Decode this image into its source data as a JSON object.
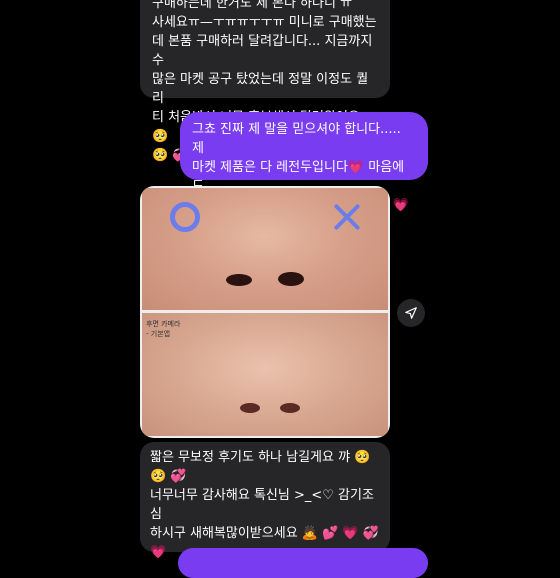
{
  "messages": {
    "incoming_1": {
      "text": "구매하는데 한거도 제 본다 하나니 ㅠ\n사세요ㅠ—ㅜㅠㅠㅜㅜㅠ 미니로 구매했는\n데 본품 구매하러 달려갑니다... 지금까지 수\n많은 마켓 공구 탔었는데 정말 이정도 퀄리\n티 처음봐서 너무 흥분해서 달려왔어요 🥺\n🥺 💞 💞"
    },
    "outgoing_1": {
      "text": "그쵸 진짜 제 말을 믿으셔야 합니다..... 제\n마켓 제품은 다 레전두입니다💗 마음에 드\n셨다니 기뻐용 감사합니다✌🏻 💗 💗 💗"
    },
    "photo_card": {
      "label": "후면 카메라\n- 기본앱"
    },
    "incoming_2": {
      "text": "짧은 무보정 후기도 하나 남길게요 꺄 🥺\n🥺 💞\n너무너무 감사해요 톡신님 >_<♡ 감기조심\n하시구 새해복많이받으세요 🙇 💕 💗 💞\n💗"
    }
  },
  "icons": {
    "share": "send-icon"
  },
  "colors": {
    "incoming_bubble": "#262629",
    "outgoing_bubble": "#7a3cf0",
    "background": "#000000"
  }
}
